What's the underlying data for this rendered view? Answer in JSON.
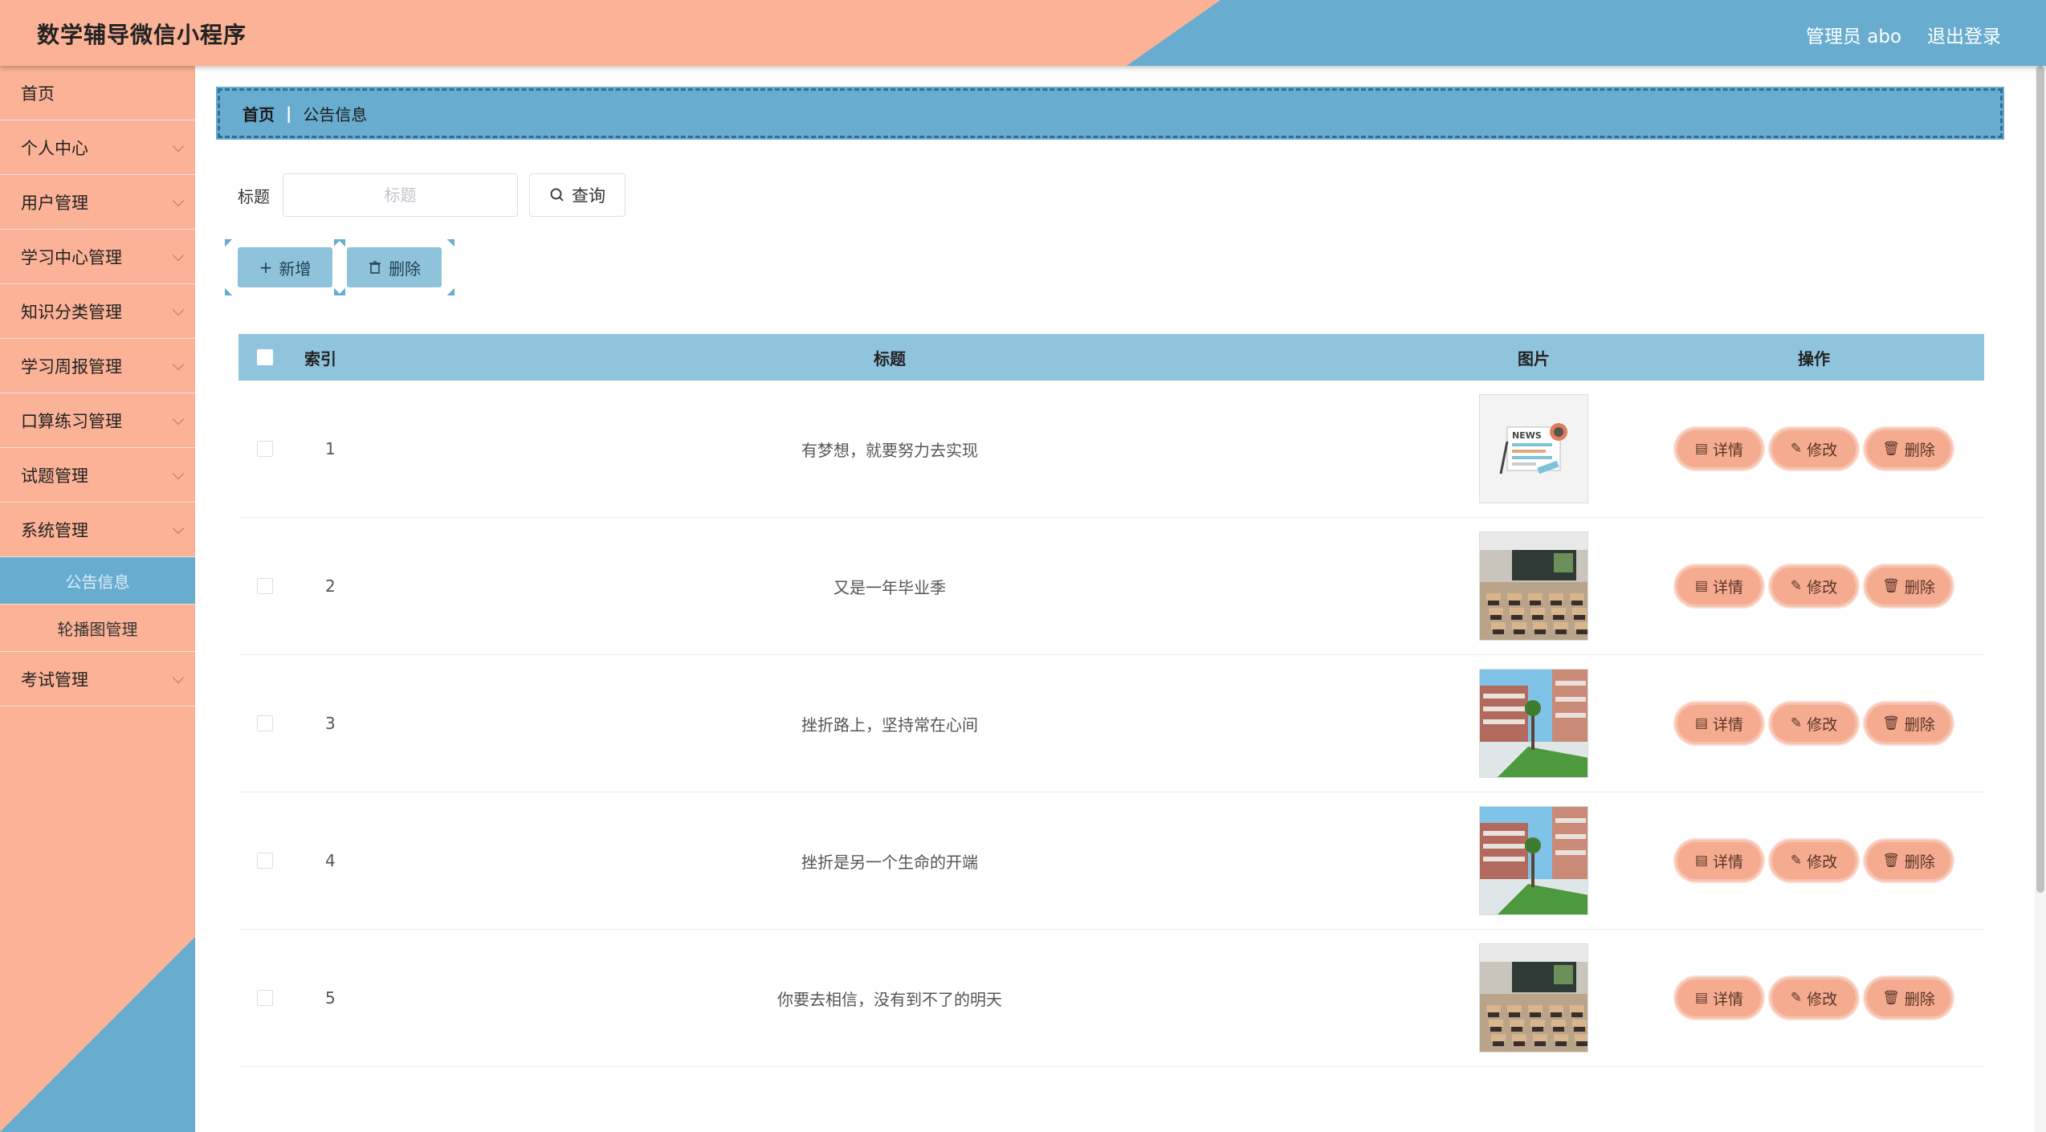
{
  "header": {
    "title": "数学辅导微信小程序",
    "user": "管理员 abo",
    "logout": "退出登录"
  },
  "sidebar": {
    "items": [
      {
        "label": "首页",
        "chevron": false
      },
      {
        "label": "个人中心",
        "chevron": true
      },
      {
        "label": "用户管理",
        "chevron": true
      },
      {
        "label": "学习中心管理",
        "chevron": true
      },
      {
        "label": "知识分类管理",
        "chevron": true
      },
      {
        "label": "学习周报管理",
        "chevron": true
      },
      {
        "label": "口算练习管理",
        "chevron": true
      },
      {
        "label": "试题管理",
        "chevron": true
      },
      {
        "label": "系统管理",
        "chevron": true
      }
    ],
    "sub_items": [
      {
        "label": "公告信息",
        "active": true
      },
      {
        "label": "轮播图管理",
        "active": false
      }
    ],
    "last_item": {
      "label": "考试管理"
    }
  },
  "breadcrumb": {
    "home": "首页",
    "separator": "|",
    "current": "公告信息"
  },
  "search": {
    "label": "标题",
    "placeholder": "标题",
    "button": "查询"
  },
  "toolbar": {
    "add": "新增",
    "delete": "删除"
  },
  "table": {
    "headers": {
      "index": "索引",
      "title": "标题",
      "picture": "图片",
      "ops": "操作"
    },
    "rows": [
      {
        "index": "1",
        "title": "有梦想，就要努力去实现",
        "pic": "news"
      },
      {
        "index": "2",
        "title": "又是一年毕业季",
        "pic": "classroom"
      },
      {
        "index": "3",
        "title": "挫折路上，坚持常在心间",
        "pic": "campus"
      },
      {
        "index": "4",
        "title": "挫折是另一个生命的开端",
        "pic": "campus"
      },
      {
        "index": "5",
        "title": "你要去相信，没有到不了的明天",
        "pic": "classroom"
      }
    ],
    "op_labels": {
      "detail": "详情",
      "edit": "修改",
      "delete": "删除"
    }
  },
  "colors": {
    "salmon": "#fbb296",
    "blue": "#68acd0",
    "header_table": "#90c4dd",
    "op_button": "#f4ab90"
  }
}
